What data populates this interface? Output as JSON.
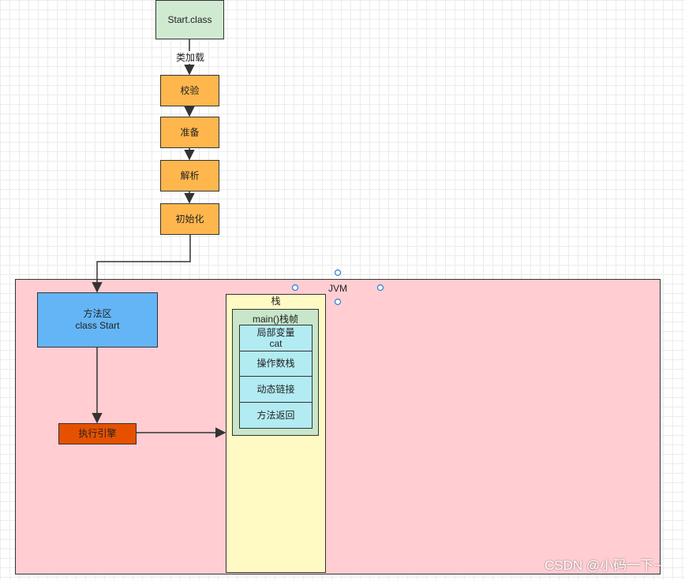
{
  "loading": {
    "start_class": "Start.class",
    "load_label": "类加载",
    "steps": [
      "校验",
      "准备",
      "解析",
      "初始化"
    ]
  },
  "jvm": {
    "title": "JVM",
    "method_area": {
      "line1": "方法区",
      "line2": "class Start"
    },
    "execution_engine": "执行引擎",
    "stack": {
      "title": "栈",
      "frame": {
        "title": "main()栈帧",
        "local_vars": {
          "line1": "局部变量",
          "line2": "cat"
        },
        "operand_stack": "操作数栈",
        "dynamic_link": "动态链接",
        "method_return": "方法返回"
      }
    }
  },
  "watermark": "CSDN @小码一下~",
  "colors": {
    "start_fill": "#d0e9d1",
    "step_fill": "#ffb74d",
    "jvm_fill": "#ffcdd2",
    "method_area_fill": "#64b5f6",
    "engine_fill": "#e65100",
    "stack_fill": "#fff9c4",
    "frame_fill": "#c8e6c9",
    "slot_fill": "#b2ebf2"
  }
}
